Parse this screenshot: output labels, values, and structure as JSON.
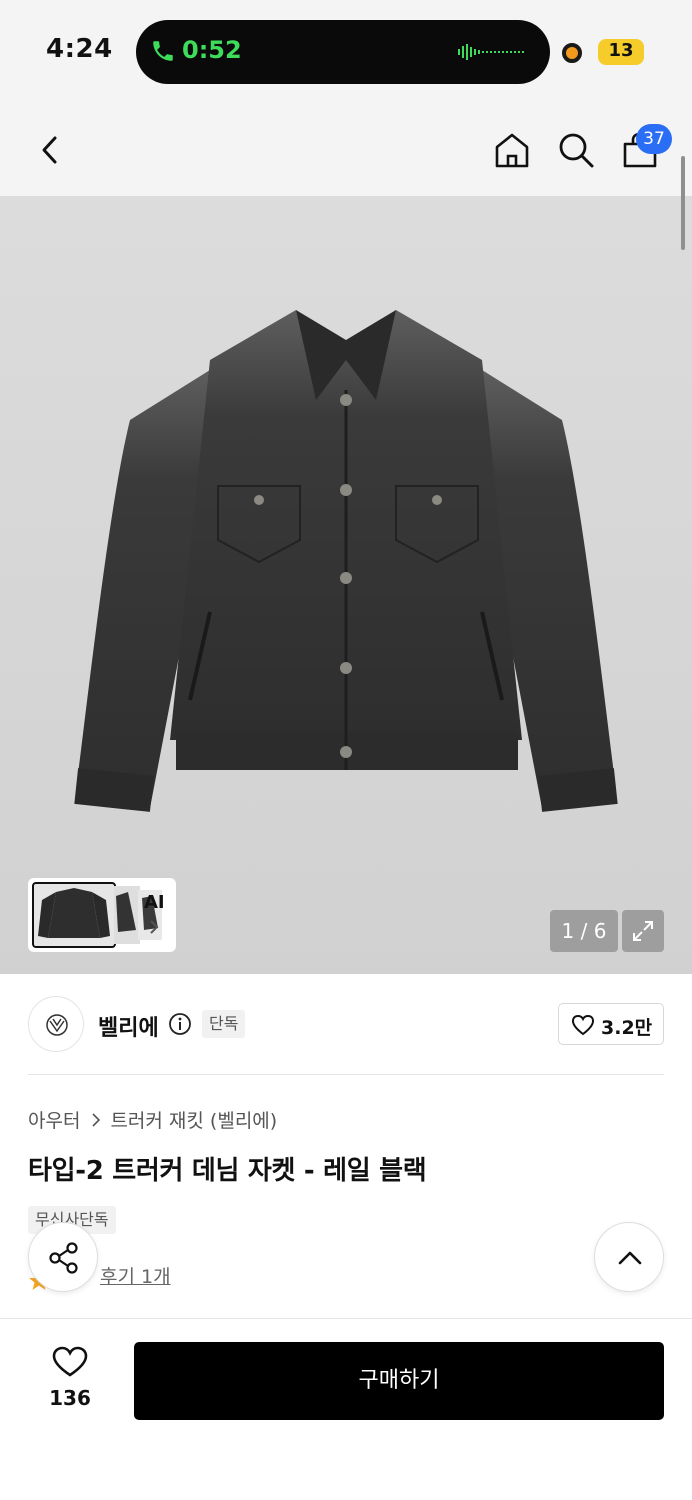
{
  "status_bar": {
    "time": "4:24",
    "call_duration": "0:52",
    "battery": "13"
  },
  "header": {
    "cart_badge": "37",
    "icons": [
      "back-icon",
      "home-icon",
      "search-icon",
      "shopping-bag-icon"
    ]
  },
  "gallery": {
    "page_counter": "1 / 6",
    "current_page": 1,
    "total_pages": 6,
    "ai_label": "AI"
  },
  "brand": {
    "name": "벨리에",
    "exclusive_tag": "단독",
    "like_count": "3.2만"
  },
  "product": {
    "breadcrumb": [
      "아우터",
      "트러커 재킷 (벨리에)"
    ],
    "title": "타입-2 트러커 데님 자켓 - 레일 블랙",
    "tag": "무신사단독",
    "review_link": "후기 1개"
  },
  "bottom_bar": {
    "wish_count": "136",
    "buy_label": "구매하기"
  },
  "colors": {
    "accent_badge": "#2a6ef5",
    "call_green": "#3ddc5a",
    "buy_button": "#000000",
    "star": "#f5a623"
  }
}
